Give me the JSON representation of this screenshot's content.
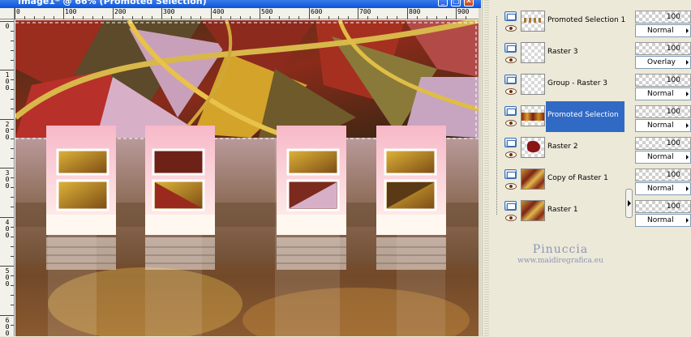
{
  "window": {
    "title": "Image1* @ 66% (Promoted Selection)",
    "buttons": [
      "_",
      "□",
      "✕"
    ],
    "icons": [
      "image-window-icon",
      "minimize-icon",
      "maximize-icon",
      "close-icon"
    ]
  },
  "rulers": {
    "top": [
      "0",
      "100",
      "200",
      "300",
      "400",
      "500",
      "600",
      "700",
      "800",
      "900"
    ],
    "left": [
      "0",
      "100",
      "200",
      "300",
      "400",
      "500",
      "600"
    ]
  },
  "layers": [
    {
      "name": "Promoted Selection 1",
      "thumb": "stripes",
      "selected": false
    },
    {
      "name": "Raster 3",
      "thumb": "empty",
      "selected": false
    },
    {
      "name": "Group - Raster 3",
      "thumb": "empty",
      "selected": false
    },
    {
      "name": "Promoted Selection",
      "thumb": "band",
      "selected": true
    },
    {
      "name": "Raster 2",
      "thumb": "blob",
      "selected": false
    },
    {
      "name": "Copy of Raster 1",
      "thumb": "full",
      "selected": false
    },
    {
      "name": "Raster 1",
      "thumb": "full",
      "selected": false
    }
  ],
  "layer_props": [
    {
      "opacity": "100",
      "blend": "Normal"
    },
    {
      "opacity": "100",
      "blend": "Overlay"
    },
    {
      "opacity": "100",
      "blend": "Normal"
    },
    {
      "opacity": "100",
      "blend": "Normal"
    },
    {
      "opacity": "100",
      "blend": "Normal"
    },
    {
      "opacity": "100",
      "blend": "Normal"
    },
    {
      "opacity": "100",
      "blend": "Normal"
    }
  ],
  "watermark": {
    "name": "Pinuccia",
    "url": "www.maidiregrafica.eu"
  },
  "colors": {
    "selection": "#316ac5",
    "title_bar": "#0a54d8",
    "palette_bg": "#ece9d8"
  }
}
